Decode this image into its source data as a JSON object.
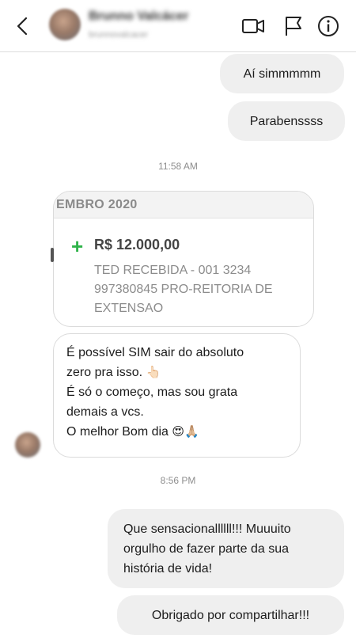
{
  "header": {
    "contact_name": "Brunno Valcácer",
    "contact_handle": "brunnovalcacer"
  },
  "messages": {
    "sent1": "Aí simmmmm",
    "sent2": "Parabenssss",
    "time1": "11:58 AM",
    "card": {
      "month": "EMBRO 2020",
      "amount": "R$ 12.000,00",
      "desc_lines": [
        "TED RECEBIDA - 001 3234",
        "997380845 PRO-REITORIA DE",
        "EXTENSAO"
      ]
    },
    "received_lines": [
      "É possível SIM sair do absoluto",
      "zero pra isso.",
      "É só o começo, mas sou grata",
      "demais a vcs.",
      "O melhor Bom dia"
    ],
    "received_emojis": {
      "pointing": "👆🏻",
      "faces": "😍🙏🏼"
    },
    "time2": "8:56 PM",
    "sent3_lines": [
      "Que sensacionallllll!!! Muuuito",
      "orgulho de fazer parte da sua",
      "história de vida!"
    ],
    "sent4": "Obrigado por compartilhar!!!"
  },
  "colors": {
    "bubble_bg": "#efefef",
    "plus_green": "#2fb34a",
    "timestamp": "#8e8e8e"
  },
  "icons": [
    "back-chevron-icon",
    "video-call-icon",
    "flag-icon",
    "info-icon",
    "plus-icon"
  ]
}
